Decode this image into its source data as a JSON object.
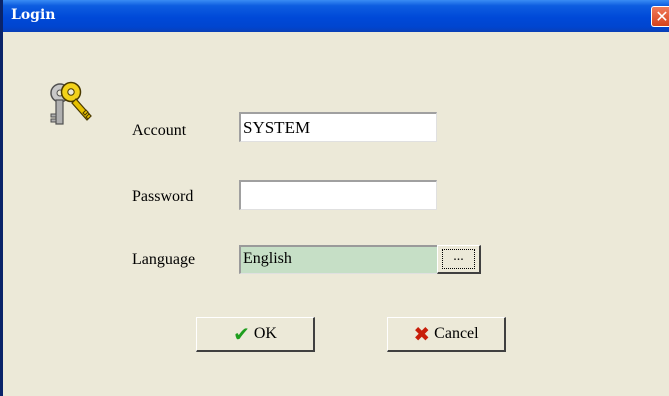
{
  "window": {
    "title": "Login",
    "close_glyph": "✕"
  },
  "form": {
    "account_label": "Account",
    "account_value": "SYSTEM",
    "password_label": "Password",
    "password_value": "",
    "language_label": "Language",
    "language_value": "English",
    "browse_label": "..."
  },
  "buttons": {
    "ok_label": "OK",
    "ok_icon": "check-icon",
    "cancel_label": "Cancel",
    "cancel_icon": "x-icon"
  },
  "icons": {
    "header_icon": "keys-icon"
  },
  "colors": {
    "titlebar": "#0049d8",
    "dialog_bg": "#ece9d8",
    "language_field_bg": "#c6dfc6",
    "ok_check": "#1e9e1e",
    "cancel_x": "#c81e0a"
  }
}
